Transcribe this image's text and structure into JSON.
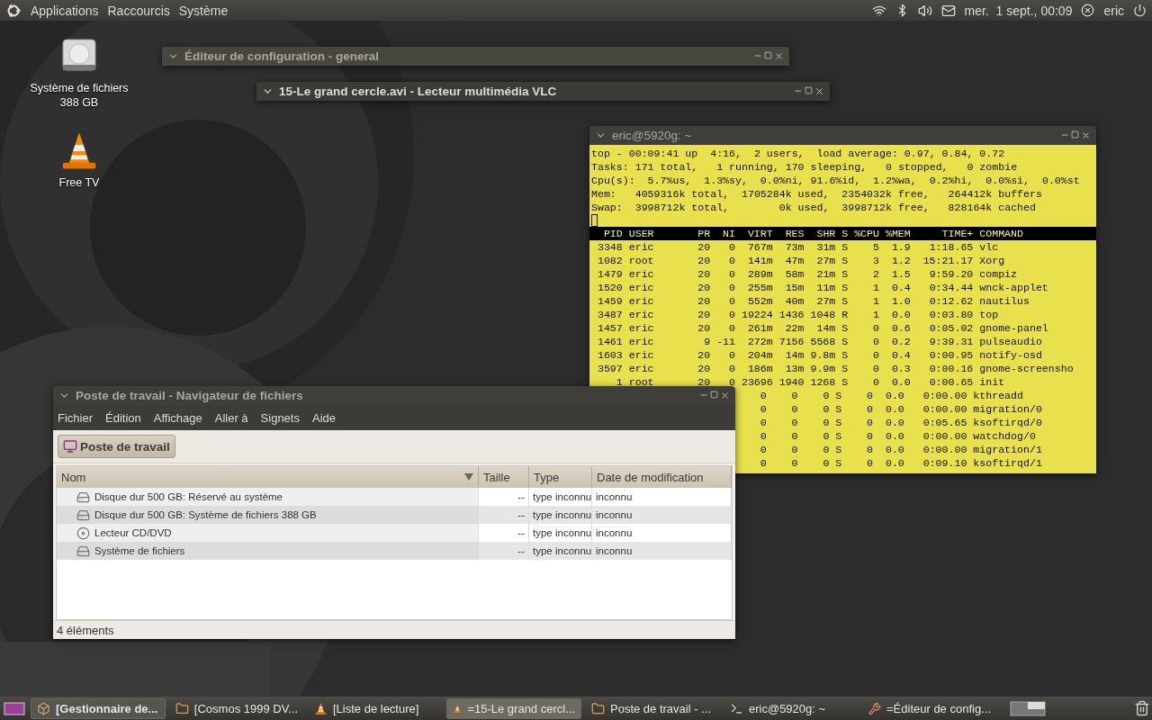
{
  "top_panel": {
    "menus": [
      "Applications",
      "Raccourcis",
      "Système"
    ],
    "clock": "mer.  1 sept., 00:09",
    "user": "eric"
  },
  "desktop_icons": [
    {
      "label": "Système de fichiers 388 GB",
      "kind": "disk"
    },
    {
      "label": "Free TV",
      "kind": "cone"
    }
  ],
  "config_editor_window": {
    "title": "Éditeur de configuration - general"
  },
  "vlc_window": {
    "title": "15-Le grand cercle.avi - Lecteur multimédia VLC"
  },
  "terminal": {
    "title": "eric@5920g: ~",
    "summary": [
      "top - 00:09:41 up  4:16,  2 users,  load average: 0.97, 0.84, 0.72",
      "Tasks: 171 total,   1 running, 170 sleeping,   0 stopped,   0 zombie",
      "Cpu(s):  5.7%us,  1.3%sy,  0.0%ni, 91.6%id,  1.2%wa,  0.2%hi,  0.0%si,  0.0%st",
      "Mem:   4059316k total,  1705284k used,  2354032k free,   264412k buffers",
      "Swap:  3998712k total,        0k used,  3998712k free,   828164k cached"
    ],
    "columns": [
      "PID",
      "USER",
      "PR",
      "NI",
      "VIRT",
      "RES",
      "SHR",
      "S",
      "%CPU",
      "%MEM",
      "TIME+",
      "COMMAND"
    ],
    "processes": [
      [
        "3348",
        "eric",
        "20",
        "0",
        "767m",
        "73m",
        "31m",
        "S",
        "5",
        "1.9",
        "1:18.65",
        "vlc"
      ],
      [
        "1082",
        "root",
        "20",
        "0",
        "141m",
        "47m",
        "27m",
        "S",
        "3",
        "1.2",
        "15:21.17",
        "Xorg"
      ],
      [
        "1479",
        "eric",
        "20",
        "0",
        "289m",
        "58m",
        "21m",
        "S",
        "2",
        "1.5",
        "9:59.20",
        "compiz"
      ],
      [
        "1520",
        "eric",
        "20",
        "0",
        "255m",
        "15m",
        "11m",
        "S",
        "1",
        "0.4",
        "0:34.44",
        "wnck-applet"
      ],
      [
        "1459",
        "eric",
        "20",
        "0",
        "552m",
        "40m",
        "27m",
        "S",
        "1",
        "1.0",
        "0:12.62",
        "nautilus"
      ],
      [
        "3487",
        "eric",
        "20",
        "0",
        "19224",
        "1436",
        "1048",
        "R",
        "1",
        "0.0",
        "0:03.80",
        "top"
      ],
      [
        "1457",
        "eric",
        "20",
        "0",
        "261m",
        "22m",
        "14m",
        "S",
        "0",
        "0.6",
        "0:05.02",
        "gnome-panel"
      ],
      [
        "1461",
        "eric",
        "9",
        "-11",
        "272m",
        "7156",
        "5568",
        "S",
        "0",
        "0.2",
        "9:39.31",
        "pulseaudio"
      ],
      [
        "1603",
        "eric",
        "20",
        "0",
        "204m",
        "14m",
        "9.8m",
        "S",
        "0",
        "0.4",
        "0:00.95",
        "notify-osd"
      ],
      [
        "3597",
        "eric",
        "20",
        "0",
        "186m",
        "13m",
        "9.9m",
        "S",
        "0",
        "0.3",
        "0:00.16",
        "gnome-screensho"
      ],
      [
        "1",
        "root",
        "20",
        "0",
        "23696",
        "1940",
        "1268",
        "S",
        "0",
        "0.0",
        "0:00.65",
        "init"
      ]
    ],
    "covered_processes": [
      [
        "0",
        "0",
        "0",
        "S",
        "0",
        "0.0",
        "0:00.00",
        "kthreadd"
      ],
      [
        "0",
        "0",
        "0",
        "S",
        "0",
        "0.0",
        "0:00.00",
        "migration/0"
      ],
      [
        "0",
        "0",
        "0",
        "S",
        "0",
        "0.0",
        "0:05.65",
        "ksoftirqd/0"
      ],
      [
        "0",
        "0",
        "0",
        "S",
        "0",
        "0.0",
        "0:00.00",
        "watchdog/0"
      ],
      [
        "0",
        "0",
        "0",
        "S",
        "0",
        "0.0",
        "0:00.00",
        "migration/1"
      ],
      [
        "0",
        "0",
        "0",
        "S",
        "0",
        "0.0",
        "0:09.10",
        "ksoftirqd/1"
      ]
    ]
  },
  "file_manager": {
    "title": "Poste de travail - Navigateur de fichiers",
    "menus": [
      "Fichier",
      "Édition",
      "Affichage",
      "Aller à",
      "Signets",
      "Aide"
    ],
    "location_button": "Poste de travail",
    "columns": [
      "Nom",
      "Taille",
      "Type",
      "Date de modification"
    ],
    "rows": [
      {
        "name": "Disque dur 500 GB: Réservé au système",
        "size": "--",
        "type": "type inconnu",
        "date": "inconnu",
        "kind": "disk"
      },
      {
        "name": "Disque dur 500 GB: Système de fichiers 388 GB",
        "size": "--",
        "type": "type inconnu",
        "date": "inconnu",
        "kind": "disk"
      },
      {
        "name": "Lecteur CD/DVD",
        "size": "--",
        "type": "type inconnu",
        "date": "inconnu",
        "kind": "cd"
      },
      {
        "name": "Système de fichiers",
        "size": "--",
        "type": "type inconnu",
        "date": "inconnu",
        "kind": "disk"
      }
    ],
    "status": "4 éléments"
  },
  "taskbar": {
    "items": [
      {
        "label": "[Gestionnaire de...",
        "kind": "box",
        "selected": false,
        "urgent": true
      },
      {
        "label": "[Cosmos 1999 DV...",
        "kind": "folder",
        "selected": false,
        "urgent": false
      },
      {
        "label": "[Liste de lecture]",
        "kind": "cone",
        "selected": false,
        "urgent": false
      },
      {
        "label": "=15-Le grand cercl...",
        "kind": "cone",
        "selected": true,
        "urgent": false
      },
      {
        "label": "Poste de travail - ...",
        "kind": "folder",
        "selected": false,
        "urgent": false
      },
      {
        "label": "eric@5920g: ~",
        "kind": "terminal",
        "selected": false,
        "urgent": false
      },
      {
        "label": "=Éditeur de config...",
        "kind": "tools",
        "selected": false,
        "urgent": false
      }
    ]
  }
}
